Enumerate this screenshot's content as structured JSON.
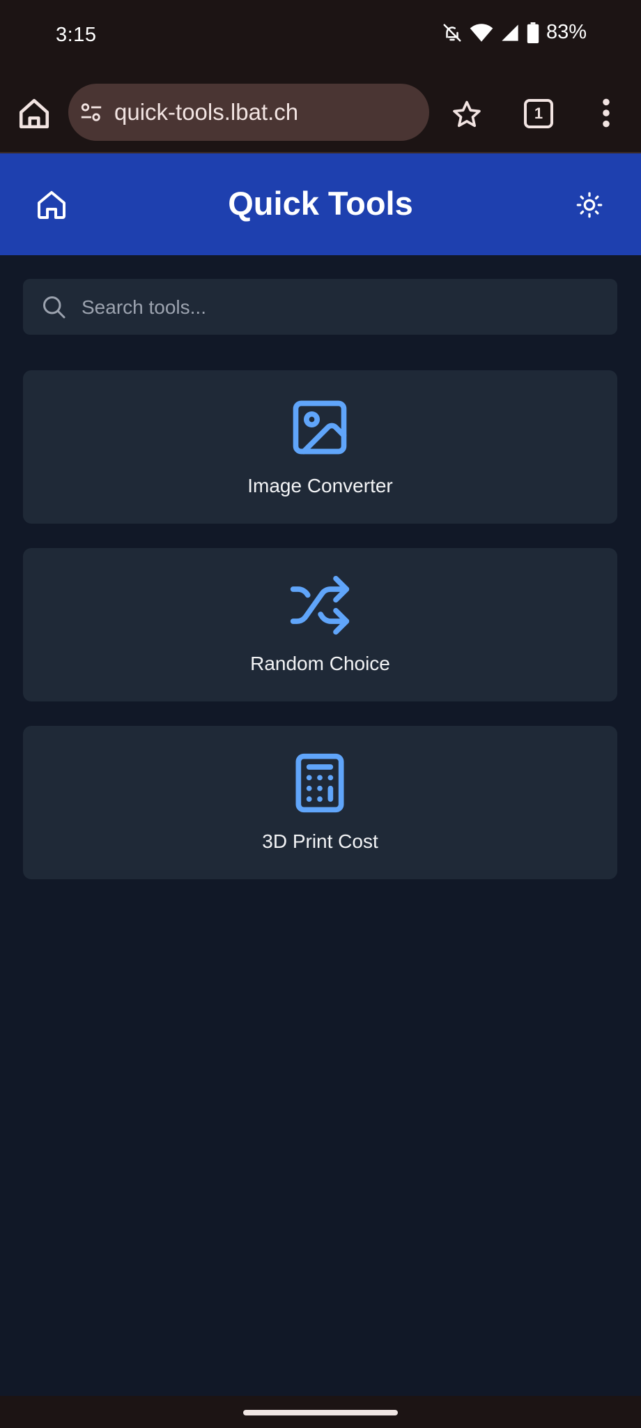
{
  "status_bar": {
    "time": "3:15",
    "battery": "83%",
    "icons": [
      "mute-icon",
      "wifi-icon",
      "signal-icon",
      "battery-icon"
    ]
  },
  "browser": {
    "url": "quick-tools.lbat.ch",
    "tab_count": "1",
    "icons": [
      "home-icon",
      "site-settings-icon",
      "star-icon",
      "tabs-icon",
      "more-vert-icon"
    ]
  },
  "app": {
    "title": "Quick Tools",
    "header_color": "#1e40af",
    "accent_color": "#60a5fa"
  },
  "search": {
    "placeholder": "Search tools...",
    "value": ""
  },
  "tools": [
    {
      "label": "Image Converter",
      "icon": "image-icon"
    },
    {
      "label": "Random Choice",
      "icon": "shuffle-icon"
    },
    {
      "label": "3D Print Cost",
      "icon": "calculator-icon"
    }
  ]
}
